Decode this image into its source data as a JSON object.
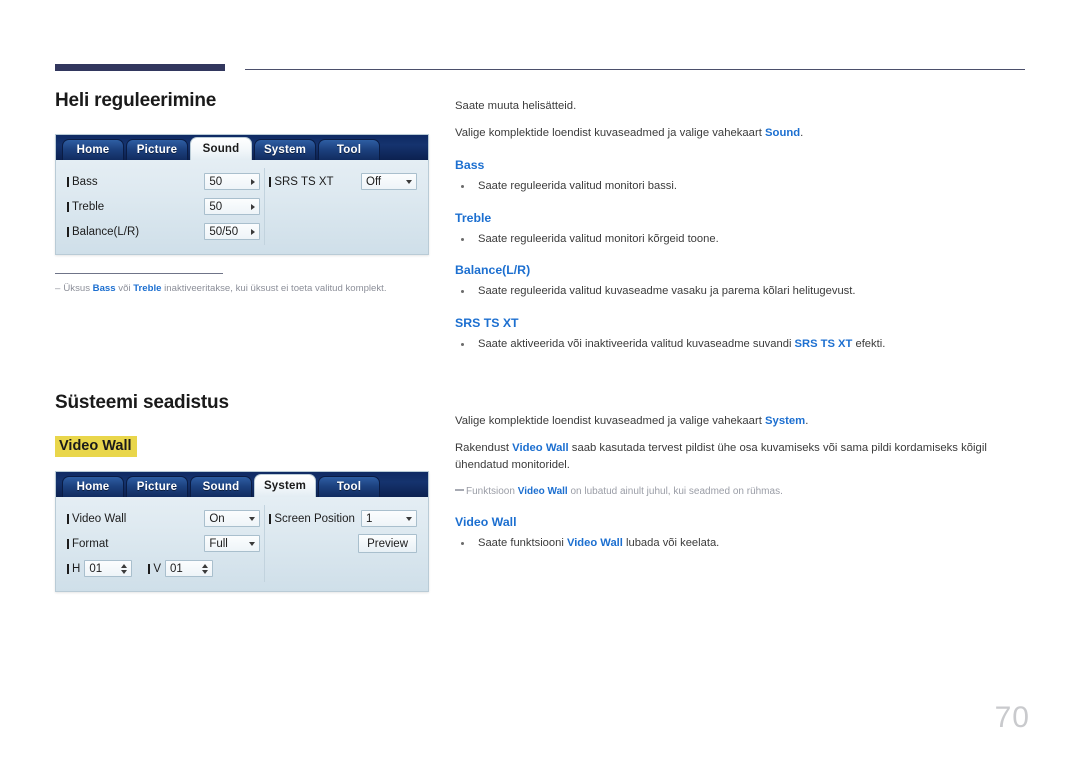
{
  "page": {
    "number": "70",
    "accent_blue": "#1c6fd0",
    "rule_color": "#32375e",
    "highlight_yellow": "#e9d64b"
  },
  "sections": [
    {
      "title": "Heli reguleerimine",
      "osd": {
        "tabs": [
          {
            "label": "Home",
            "active": false
          },
          {
            "label": "Picture",
            "active": false
          },
          {
            "label": "Sound",
            "active": true
          },
          {
            "label": "System",
            "active": false
          },
          {
            "label": "Tool",
            "active": false
          }
        ],
        "left_rows": [
          {
            "label": "Bass",
            "value": "50",
            "control": "arrow-right"
          },
          {
            "label": "Treble",
            "value": "50",
            "control": "arrow-right"
          },
          {
            "label": "Balance(L/R)",
            "value": "50/50",
            "control": "arrow-right"
          }
        ],
        "right_rows": [
          {
            "label": "SRS TS XT",
            "value": "Off",
            "control": "arrow-down"
          }
        ]
      },
      "footnote": {
        "dash": "–",
        "parts": [
          {
            "t": "Üksus ",
            "b": false
          },
          {
            "t": "Bass",
            "b": true
          },
          {
            "t": " või ",
            "b": false
          },
          {
            "t": "Treble",
            "b": true
          },
          {
            "t": " inaktiveeritakse, kui üksust ei toeta valitud komplekt.",
            "b": false
          }
        ]
      }
    },
    {
      "title": "Süsteemi seadistus",
      "highlight_label": "Video Wall",
      "osd": {
        "tabs": [
          {
            "label": "Home",
            "active": false
          },
          {
            "label": "Picture",
            "active": false
          },
          {
            "label": "Sound",
            "active": false
          },
          {
            "label": "System",
            "active": true
          },
          {
            "label": "Tool",
            "active": false
          }
        ],
        "rows": {
          "video_wall_label": "Video Wall",
          "video_wall_value": "On",
          "format_label": "Format",
          "format_value": "Full",
          "h_label": "H",
          "h_value": "01",
          "v_label": "V",
          "v_value": "01",
          "screen_position_label": "Screen Position",
          "screen_position_value": "1",
          "preview_label": "Preview"
        }
      }
    }
  ],
  "right_column": {
    "sound": {
      "intro_1": "Saate muuta helisätteid.",
      "intro_2_pre": "Valige komplektide loendist kuvaseadmed ja valige vahekaart ",
      "intro_2_link": "Sound",
      "intro_2_post": ".",
      "items": [
        {
          "head": "Bass",
          "bullet_pre": "Saate reguleerida valitud monitori bassi.",
          "bullet_link": "",
          "bullet_post": ""
        },
        {
          "head": "Treble",
          "bullet_pre": "Saate reguleerida valitud monitori kõrgeid toone.",
          "bullet_link": "",
          "bullet_post": ""
        },
        {
          "head": "Balance(L/R)",
          "bullet_pre": "Saate reguleerida valitud kuvaseadme vasaku ja parema kõlari helitugevust.",
          "bullet_link": "",
          "bullet_post": ""
        },
        {
          "head": "SRS TS XT",
          "bullet_pre": "Saate aktiveerida või inaktiveerida valitud kuvaseadme suvandi ",
          "bullet_link": "SRS TS XT",
          "bullet_post": " efekti."
        }
      ]
    },
    "system": {
      "intro_1_pre": "Valige komplektide loendist kuvaseadmed ja valige vahekaart ",
      "intro_1_link": "System",
      "intro_1_post": ".",
      "intro_2_pre": "Rakendust ",
      "intro_2_link": "Video Wall",
      "intro_2_post": " saab kasutada tervest pildist ühe osa kuvamiseks või sama pildi kordamiseks kõigil ühendatud monitoridel.",
      "note_pre": "Funktsioon ",
      "note_link": "Video Wall",
      "note_post": " on lubatud ainult juhul, kui seadmed on rühmas.",
      "item": {
        "head": "Video Wall",
        "bullet_pre": "Saate funktsiooni ",
        "bullet_link": "Video Wall",
        "bullet_post": " lubada või keelata."
      }
    }
  }
}
